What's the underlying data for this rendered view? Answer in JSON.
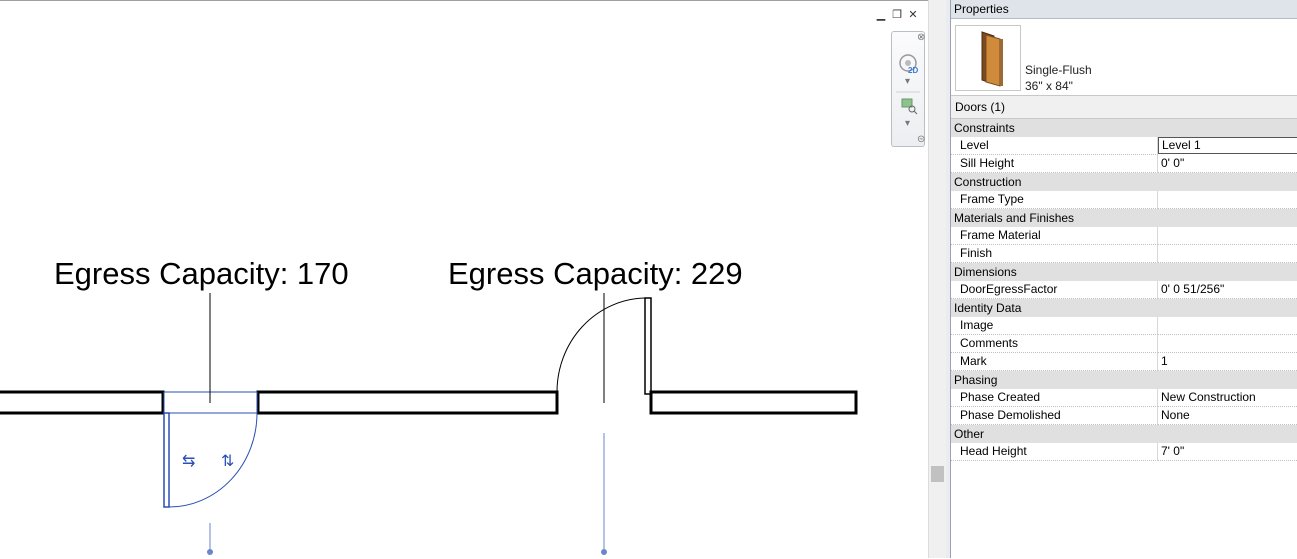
{
  "canvas": {
    "tag_left": "Egress Capacity: 170",
    "tag_right": "Egress Capacity: 229",
    "controls": [
      "minimize-icon",
      "restore-icon",
      "close-icon"
    ]
  },
  "navbar": {
    "zoom_badge": "2D"
  },
  "properties": {
    "title": "Properties",
    "type_line1": "Single-Flush",
    "type_line2": "36\" x 84\"",
    "instance_selector": "Doors (1)",
    "groups": [
      {
        "name": "Constraints",
        "rows": [
          {
            "k": "Level",
            "v": "Level 1"
          },
          {
            "k": "Sill Height",
            "v": "0'  0\""
          }
        ]
      },
      {
        "name": "Construction",
        "rows": [
          {
            "k": "Frame Type",
            "v": ""
          }
        ]
      },
      {
        "name": "Materials and Finishes",
        "rows": [
          {
            "k": "Frame Material",
            "v": ""
          },
          {
            "k": "Finish",
            "v": ""
          }
        ]
      },
      {
        "name": "Dimensions",
        "rows": [
          {
            "k": "DoorEgressFactor",
            "v": "0'  0 51/256\""
          }
        ]
      },
      {
        "name": "Identity Data",
        "rows": [
          {
            "k": "Image",
            "v": ""
          },
          {
            "k": "Comments",
            "v": ""
          },
          {
            "k": "Mark",
            "v": "1"
          }
        ]
      },
      {
        "name": "Phasing",
        "rows": [
          {
            "k": "Phase Created",
            "v": "New Construction"
          },
          {
            "k": "Phase Demolished",
            "v": "None"
          }
        ]
      },
      {
        "name": "Other",
        "rows": [
          {
            "k": "Head Height",
            "v": "7'  0\""
          }
        ]
      }
    ]
  }
}
